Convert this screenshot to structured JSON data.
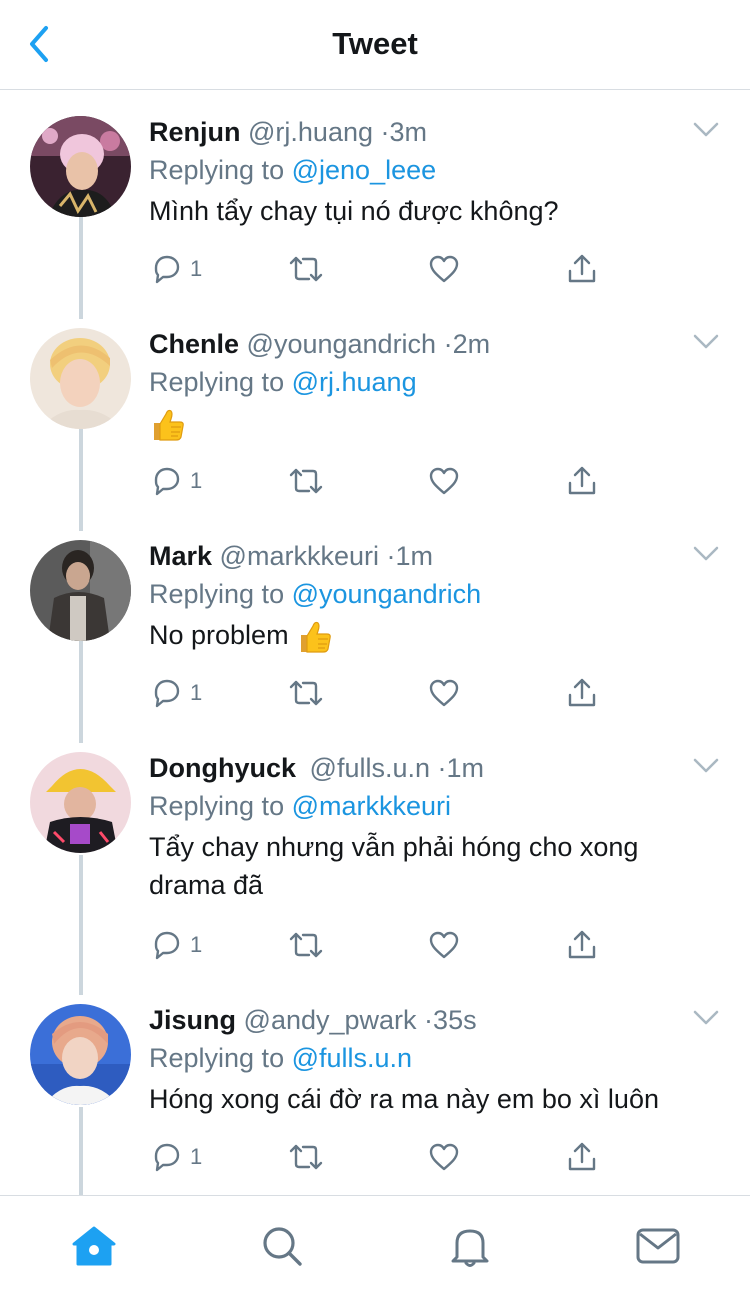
{
  "header": {
    "title": "Tweet",
    "back_icon": "chevron-left-icon"
  },
  "colors": {
    "accent": "#1DA1F2",
    "link": "#1B95E0",
    "muted": "#657786",
    "thread_line": "#CCD6DD"
  },
  "tweets": [
    {
      "name": "Renjun",
      "handle": "@rj.huang",
      "time": "3m",
      "replying_label": "Replying to",
      "replying_to": "@jeno_leee",
      "text": "Mình tẩy chay tụi nó được không?",
      "reply_count": "1"
    },
    {
      "name": "Chenle",
      "handle": "@youngandrich",
      "time": "2m",
      "replying_label": "Replying to",
      "replying_to": "@rj.huang",
      "text": "",
      "emoji": "thumbs-up",
      "reply_count": "1"
    },
    {
      "name": "Mark",
      "handle": "@markkkeuri",
      "time": "1m",
      "replying_label": "Replying to",
      "replying_to": "@youngandrich",
      "text": "No problem",
      "emoji": "thumbs-up",
      "reply_count": "1"
    },
    {
      "name": "Donghyuck",
      "handle": "@fulls.u.n",
      "time": "1m",
      "replying_label": "Replying to",
      "replying_to": "@markkkeuri",
      "text_lines": [
        "Tẩy chay nhưng vẫn phải hóng cho xong",
        "drama đã"
      ],
      "reply_count": "1"
    },
    {
      "name": "Jisung",
      "handle": "@andy_pwark",
      "time": "35s",
      "replying_label": "Replying to",
      "replying_to": "@fulls.u.n",
      "text": "Hóng xong cái đờ ra ma này em bo xì luôn",
      "reply_count": "1"
    }
  ],
  "tabbar": {
    "items": [
      "home-icon",
      "search-icon",
      "bell-icon",
      "mail-icon"
    ],
    "active": "home-icon"
  },
  "separator": "·"
}
